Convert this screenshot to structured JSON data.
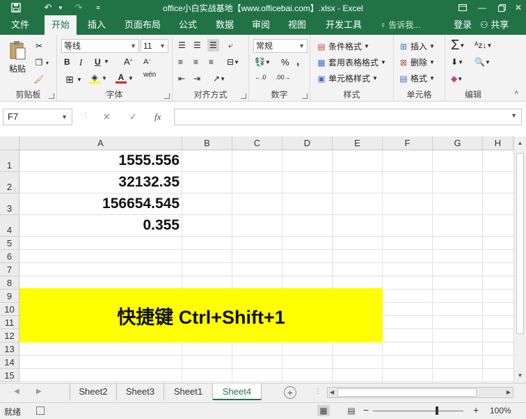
{
  "window": {
    "title": "office小白实战基地【www.officebai.com】.xlsx - Excel",
    "brand_color": "#217346"
  },
  "ribbon_tabs": [
    {
      "label": "文件"
    },
    {
      "label": "开始",
      "active": true
    },
    {
      "label": "插入"
    },
    {
      "label": "页面布局"
    },
    {
      "label": "公式"
    },
    {
      "label": "数据"
    },
    {
      "label": "审阅"
    },
    {
      "label": "视图"
    },
    {
      "label": "开发工具"
    }
  ],
  "tell_me": "告诉我...",
  "login": "登录",
  "share": "共享",
  "ribbon": {
    "clipboard": {
      "paste": "粘贴",
      "label": "剪贴板"
    },
    "font": {
      "name": "等线",
      "size": "11",
      "bold": "B",
      "italic": "I",
      "underline": "U",
      "label": "字体"
    },
    "alignment": {
      "label": "对齐方式"
    },
    "number": {
      "format": "常规",
      "label": "数字",
      "percent": "%",
      "comma": ","
    },
    "styles": {
      "conditional": "条件格式",
      "table": "套用表格格式",
      "cell": "单元格样式",
      "label": "样式"
    },
    "cells": {
      "insert": "插入",
      "delete": "删除",
      "format": "格式",
      "label": "单元格"
    },
    "editing": {
      "label": "编辑"
    }
  },
  "formula_bar": {
    "name_box": "F7",
    "cancel": "✕",
    "enter": "✓",
    "fx": "fx",
    "value": ""
  },
  "columns": [
    "A",
    "B",
    "C",
    "D",
    "E",
    "F",
    "G",
    "H"
  ],
  "rows": [
    "1",
    "2",
    "3",
    "4",
    "5",
    "6",
    "7",
    "8",
    "9",
    "10",
    "11",
    "12",
    "13",
    "14",
    "15"
  ],
  "cells": {
    "A1": "1555.556",
    "A2": "32132.35",
    "A3": "156654.545",
    "A4": "0.355"
  },
  "banner": {
    "text": "快捷键 Ctrl+Shift+1",
    "color": "#ffff00"
  },
  "sheets": [
    {
      "name": "Sheet2"
    },
    {
      "name": "Sheet3"
    },
    {
      "name": "Sheet1"
    },
    {
      "name": "Sheet4",
      "active": true
    }
  ],
  "status": {
    "ready": "就绪",
    "zoom": "100%"
  }
}
